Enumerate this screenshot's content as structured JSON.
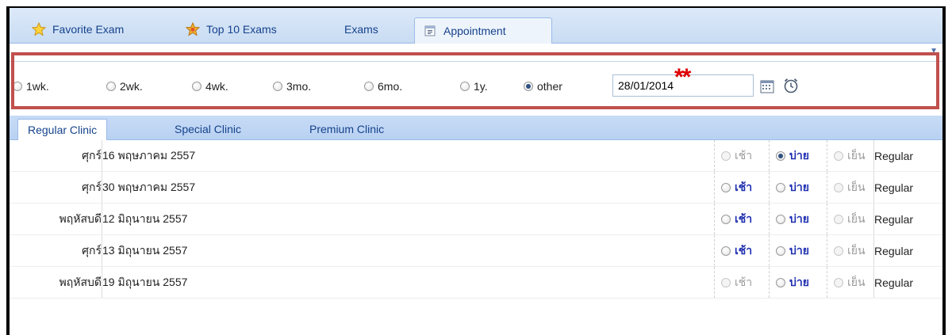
{
  "tabs": [
    {
      "label": "Favorite Exam",
      "icon": "star-icon"
    },
    {
      "label": "Top 10 Exams",
      "icon": "badge-star-icon"
    },
    {
      "label": "Exams",
      "icon": ""
    },
    {
      "label": "Appointment",
      "icon": "calendar-doc-icon"
    }
  ],
  "active_tab": "Appointment",
  "interval_options": [
    {
      "label": "1wk.",
      "checked": false
    },
    {
      "label": "2wk.",
      "checked": false
    },
    {
      "label": "4wk.",
      "checked": false
    },
    {
      "label": "3mo.",
      "checked": false
    },
    {
      "label": "6mo.",
      "checked": false
    },
    {
      "label": "1y.",
      "checked": false
    },
    {
      "label": "other",
      "checked": true
    }
  ],
  "date_value": "28/01/2014",
  "annotation_marker": "**",
  "annotation_color": "#c0504d",
  "clinic_tabs": [
    {
      "label": "Regular Clinic"
    },
    {
      "label": "Special Clinic"
    },
    {
      "label": "Premium Clinic"
    }
  ],
  "active_clinic_tab": "Regular Clinic",
  "slot_labels": {
    "morning": "เช้า",
    "afternoon": "บ่าย",
    "evening": "เย็น"
  },
  "rows": [
    {
      "day": "ศุกร์",
      "date": "16 พฤษภาคม 2557",
      "morning": {
        "enabled": false,
        "checked": false
      },
      "afternoon": {
        "enabled": true,
        "checked": true
      },
      "evening": {
        "enabled": false,
        "checked": false
      },
      "type": "Regular"
    },
    {
      "day": "ศุกร์",
      "date": "30 พฤษภาคม 2557",
      "morning": {
        "enabled": true,
        "checked": false
      },
      "afternoon": {
        "enabled": true,
        "checked": false
      },
      "evening": {
        "enabled": false,
        "checked": false
      },
      "type": "Regular"
    },
    {
      "day": "พฤหัสบดี",
      "date": "12 มิถุนายน 2557",
      "morning": {
        "enabled": true,
        "checked": false
      },
      "afternoon": {
        "enabled": true,
        "checked": false
      },
      "evening": {
        "enabled": false,
        "checked": false
      },
      "type": "Regular"
    },
    {
      "day": "ศุกร์",
      "date": "13 มิถุนายน 2557",
      "morning": {
        "enabled": true,
        "checked": false
      },
      "afternoon": {
        "enabled": true,
        "checked": false
      },
      "evening": {
        "enabled": false,
        "checked": false
      },
      "type": "Regular"
    },
    {
      "day": "พฤหัสบดี",
      "date": "19 มิถุนายน 2557",
      "morning": {
        "enabled": false,
        "checked": false
      },
      "afternoon": {
        "enabled": true,
        "checked": false
      },
      "evening": {
        "enabled": false,
        "checked": false
      },
      "type": "Regular"
    }
  ]
}
